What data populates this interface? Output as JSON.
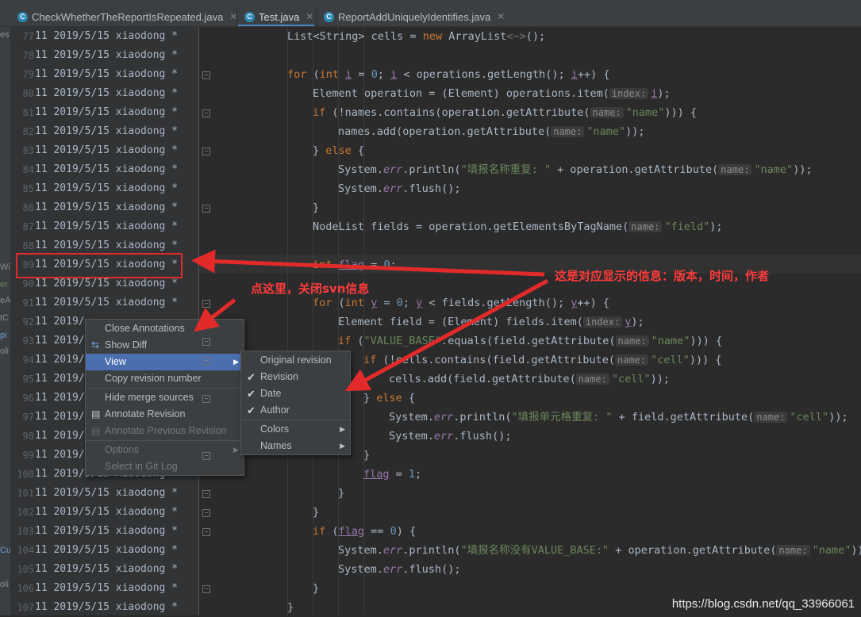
{
  "tabs": [
    {
      "label": "CheckWhetherTheReportIsRepeated.java",
      "icon": "c-class-icon"
    },
    {
      "label": "Test.java",
      "icon": "c-class-icon"
    },
    {
      "label": "ReportAddUniquelyIdentifies.java",
      "icon": "c-class-icon"
    }
  ],
  "left_fragments": [
    "es",
    "Wi",
    "er",
    "eA",
    "tC",
    "pi",
    "oli",
    "Cu",
    "oli"
  ],
  "annotation_text": "11 2019/5/15 xiaodong *",
  "annotation_partial": "11 2019/",
  "line_numbers": [
    "77",
    "78",
    "79",
    "80",
    "81",
    "82",
    "83",
    "84",
    "85",
    "86",
    "87",
    "88",
    "89",
    "90",
    "91",
    "92",
    "93",
    "94",
    "95",
    "96",
    "97",
    "98",
    "99",
    "100",
    "101",
    "102",
    "103",
    "104",
    "105",
    "106",
    "107"
  ],
  "context_menu": {
    "items": [
      {
        "label": "Close Annotations",
        "icon": ""
      },
      {
        "label": "Show Diff",
        "icon": "diff-icon"
      },
      {
        "label": "View",
        "submenu": true,
        "selected": true
      },
      {
        "label": "Copy revision number"
      },
      {
        "label": "Hide merge sources"
      },
      {
        "label": "Annotate Revision",
        "icon": "annotate-icon"
      },
      {
        "label": "Annotate Previous Revision",
        "icon": "annotate-icon",
        "disabled": true
      },
      {
        "label": "Options",
        "submenu": true,
        "disabled": true
      },
      {
        "label": "Select in Git Log",
        "disabled": true
      }
    ]
  },
  "view_submenu": {
    "items": [
      {
        "label": "Original revision",
        "checked": false
      },
      {
        "label": "Revision",
        "checked": true
      },
      {
        "label": "Date",
        "checked": true
      },
      {
        "label": "Author",
        "checked": true
      },
      {
        "label": "Colors",
        "submenu": true
      },
      {
        "label": "Names",
        "submenu": true
      }
    ]
  },
  "callouts": {
    "click_here": "点这里，关闭svn信息",
    "info": "这是对应显示的信息：版本，时间，作者"
  },
  "watermark": "https://blog.csdn.net/qq_33966061",
  "code": {
    "l77": [
      "List<String> cells = ",
      "new",
      " ArrayList",
      "<~>",
      "();"
    ],
    "l79": [
      "for",
      " (",
      "int",
      " ",
      "i",
      " = ",
      "0",
      "; ",
      "i",
      " < operations.getLength(); ",
      "i",
      "++) {"
    ],
    "l80": [
      "Element operation = (Element) operations.item(",
      "index:",
      "i",
      ");"
    ],
    "l81": [
      "if",
      " (!names.contains(operation.getAttribute(",
      "name:",
      "\"name\"",
      "))) {"
    ],
    "l82": [
      "names.add(operation.getAttribute(",
      "name:",
      "\"name\"",
      "));"
    ],
    "l83": [
      "} ",
      "else",
      " {"
    ],
    "l84": [
      "System.",
      "err",
      ".println(",
      "\"填报名称重复: \"",
      " + operation.getAttribute(",
      "name:",
      "\"name\"",
      "));"
    ],
    "l85": [
      "System.",
      "err",
      ".flush();"
    ],
    "l86": [
      "}"
    ],
    "l87": [
      "NodeList fields = operation.getElementsByTagName(",
      "name:",
      "\"field\"",
      ");"
    ],
    "l89": [
      "int",
      " ",
      "flag",
      " = ",
      "0",
      ";"
    ],
    "l91": [
      "for",
      " (",
      "int",
      " ",
      "y",
      " = ",
      "0",
      "; ",
      "y",
      " < fields.getLength(); ",
      "y",
      "++) {"
    ],
    "l92": [
      "Element field = (Element) fields.item(",
      "index:",
      "y",
      ");"
    ],
    "l93": [
      "if",
      " (",
      "\"VALUE_BASE\"",
      ".equals(field.getAttribute(",
      "name:",
      "\"name\"",
      "))) {"
    ],
    "l94": [
      "if",
      " (!cells.contains(field.getAttribute(",
      "name:",
      "\"cell\"",
      "))) {"
    ],
    "l95": [
      "cells.add(field.getAttribute(",
      "name:",
      "\"cell\"",
      "));"
    ],
    "l96": [
      "} ",
      "else",
      " {"
    ],
    "l97": [
      "System.",
      "err",
      ".println(",
      "\"填报单元格重复: \"",
      " + field.getAttribute(",
      "name:",
      "\"cell\"",
      "));"
    ],
    "l98": [
      "System.",
      "err",
      ".flush();"
    ],
    "l99": [
      "}"
    ],
    "l100": [
      "flag",
      " = ",
      "1",
      ";"
    ],
    "l101": [
      "}"
    ],
    "l102": [
      "}"
    ],
    "l103": [
      "if",
      " (",
      "flag",
      " == ",
      "0",
      ") {"
    ],
    "l104": [
      "System.",
      "err",
      ".println(",
      "\"填报名称没有VALUE_BASE:\"",
      " + operation.getAttribute(",
      "name:",
      "\"name\"",
      "));"
    ],
    "l105": [
      "System.",
      "err",
      ".flush();"
    ],
    "l106": [
      "}"
    ],
    "l107": [
      "}"
    ]
  },
  "colors": {
    "accent": "#4b6eaf",
    "annotation_red": "#e22a2a",
    "keyword": "#cc7832",
    "string": "#6a8759"
  }
}
